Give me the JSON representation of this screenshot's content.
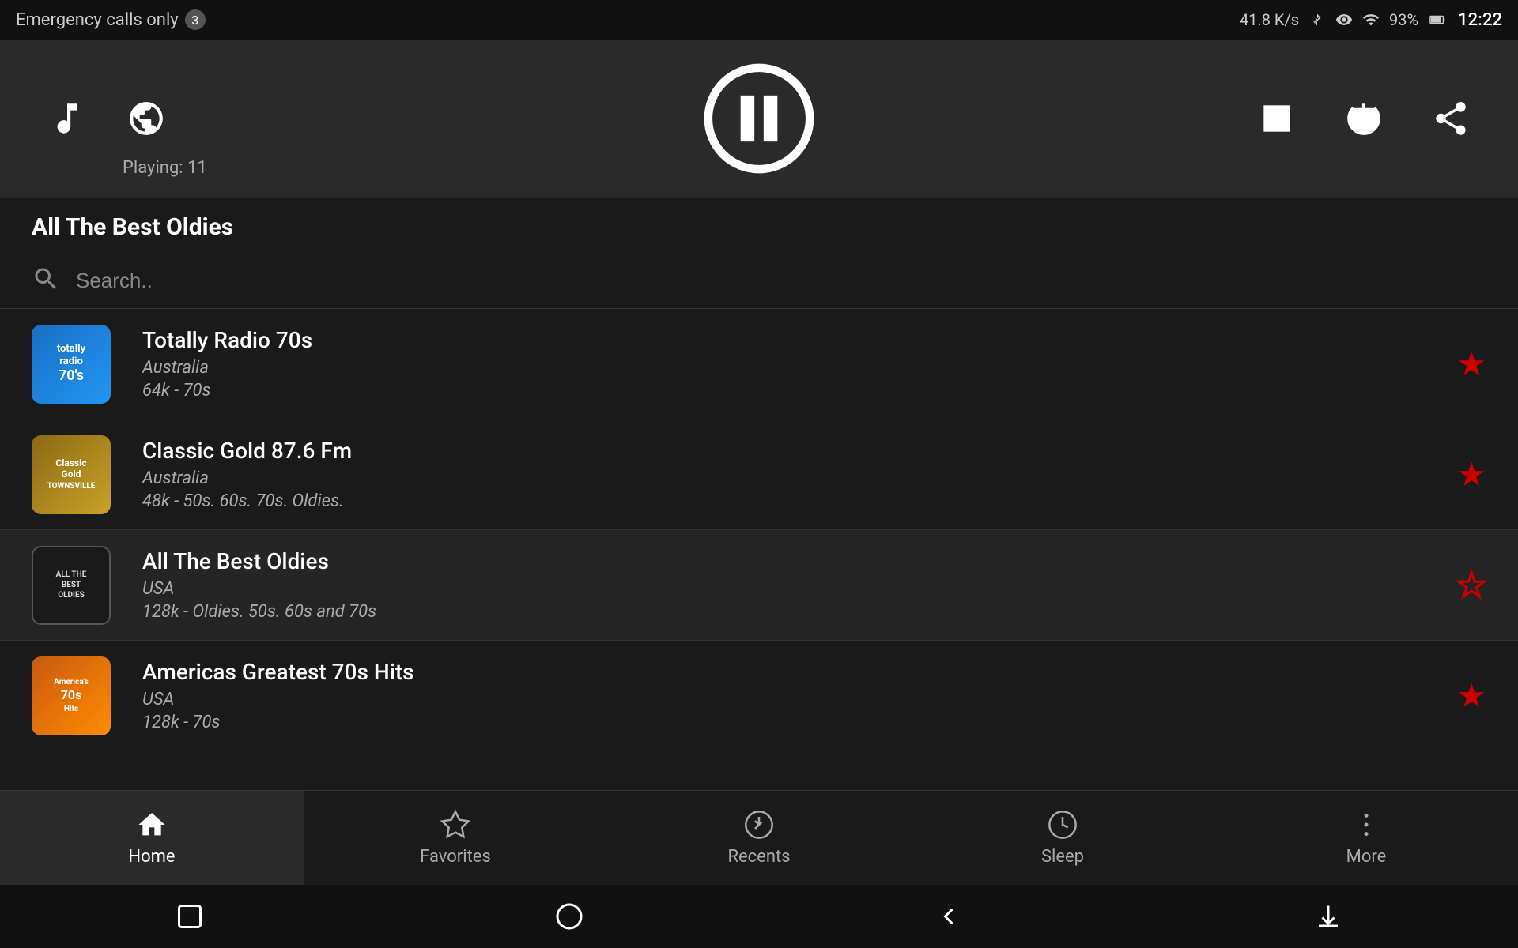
{
  "statusBar": {
    "emergency": "Emergency calls only",
    "notificationCount": "3",
    "speed": "41.8 K/s",
    "time": "12:22",
    "battery": "93%"
  },
  "player": {
    "playingLabel": "Playing: 11",
    "currentStation": "All The Best Oldies"
  },
  "search": {
    "placeholder": "Search.."
  },
  "stations": [
    {
      "name": "Totally Radio 70s",
      "country": "Australia",
      "meta": "64k - 70s",
      "logoText": "totally\nradio\n70's",
      "logoClass": "logo-70s",
      "favorited": true
    },
    {
      "name": "Classic Gold 87.6 Fm",
      "country": "Australia",
      "meta": "48k - 50s. 60s. 70s. Oldies.",
      "logoText": "Classic\nGold\nTOWNSVILLE",
      "logoClass": "logo-classic",
      "favorited": true
    },
    {
      "name": "All The Best Oldies",
      "country": "USA",
      "meta": "128k - Oldies. 50s. 60s and 70s",
      "logoText": "ALL THE\nBEST\nOLDIES",
      "logoClass": "logo-oldies",
      "favorited": false
    },
    {
      "name": "Americas Greatest 70s Hits",
      "country": "USA",
      "meta": "128k - 70s",
      "logoText": "America's\n70s\nHits",
      "logoClass": "logo-americas",
      "favorited": true
    }
  ],
  "bottomNav": [
    {
      "id": "home",
      "label": "Home",
      "active": true
    },
    {
      "id": "favorites",
      "label": "Favorites",
      "active": false
    },
    {
      "id": "recents",
      "label": "Recents",
      "active": false
    },
    {
      "id": "sleep",
      "label": "Sleep",
      "active": false
    },
    {
      "id": "more",
      "label": "More",
      "active": false
    }
  ]
}
